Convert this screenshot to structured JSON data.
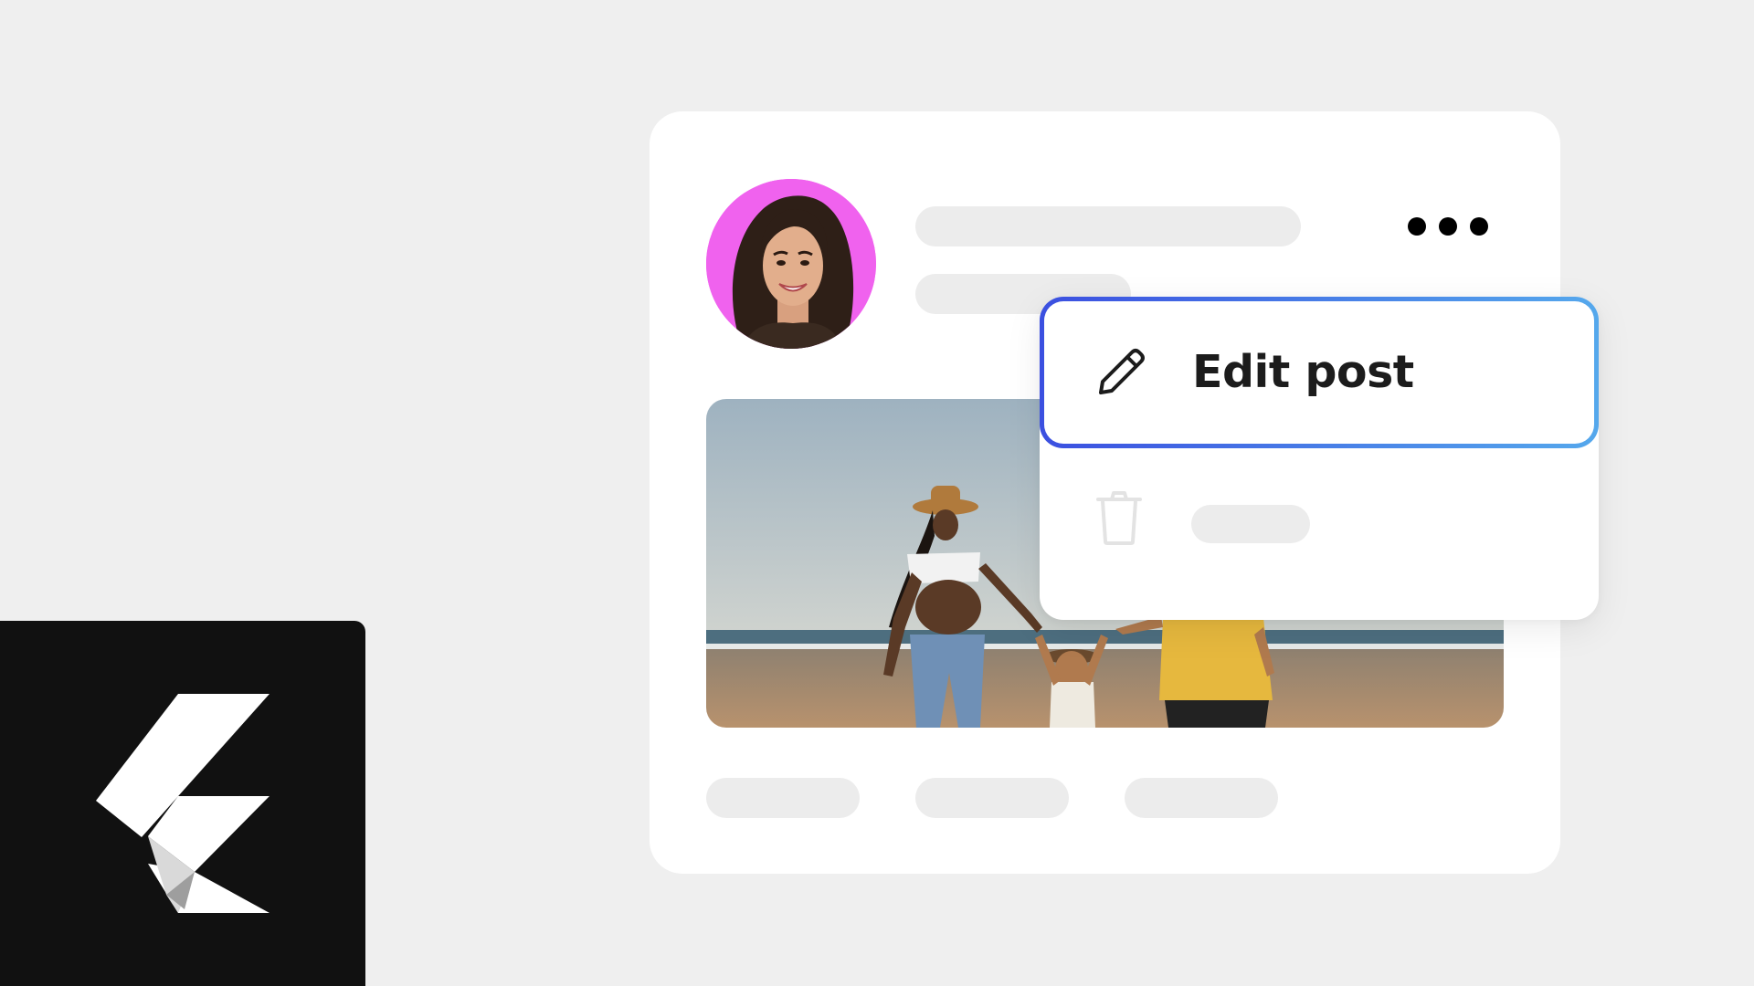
{
  "menu": {
    "edit_label": "Edit post",
    "edit_icon": "pencil-icon",
    "delete_icon": "trash-icon"
  },
  "header": {
    "more_icon": "more-horizontal-icon"
  },
  "colors": {
    "background": "#efefef",
    "card": "#ffffff",
    "skeleton": "#ececec",
    "avatar_background": "#f062ee",
    "focus_gradient_start": "#3b4fe0",
    "focus_gradient_end": "#55a8ec",
    "logo_tile": "#111111"
  }
}
